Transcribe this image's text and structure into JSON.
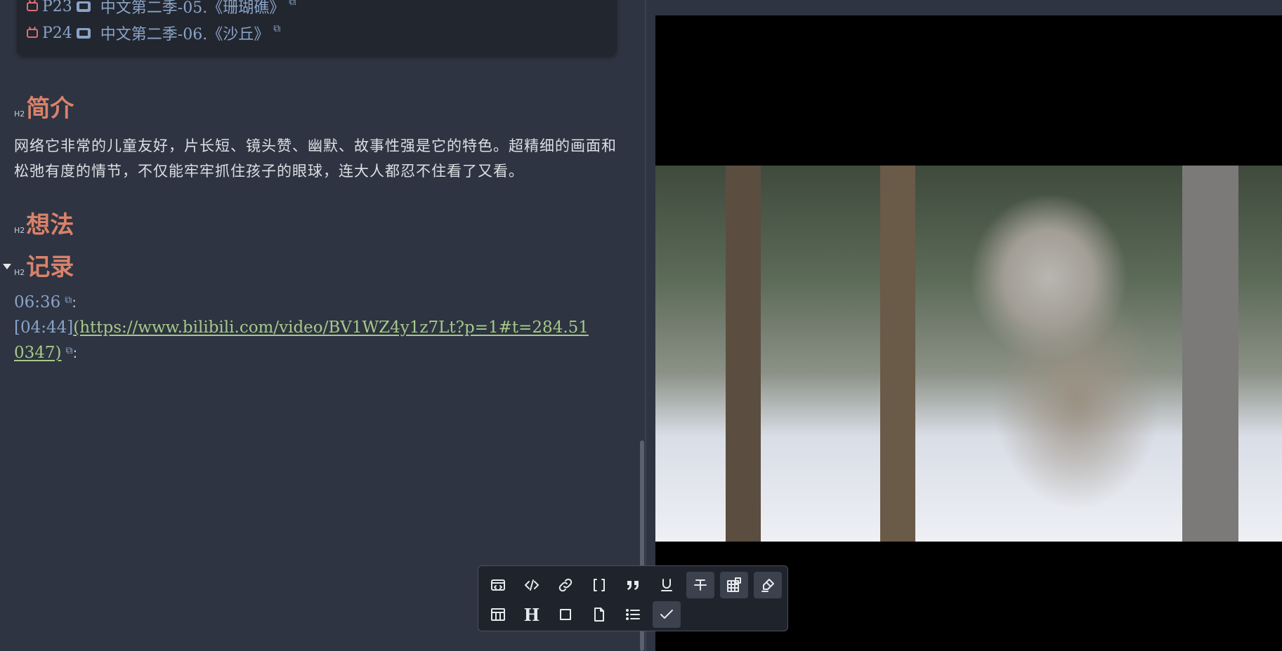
{
  "episodes": [
    {
      "label": "P23",
      "title": "中文第二季-05.《珊瑚礁》"
    },
    {
      "label": "P24",
      "title": "中文第二季-06.《沙丘》"
    }
  ],
  "sections": {
    "intro": {
      "tag": "H2",
      "title": "简介",
      "text": "网络它非常的儿童友好，片长短、镜头赞、幽默、故事性强是它的特色。超精细的画面和松弛有度的情节，不仅能牢牢抓住孩子的眼球，连大人都忍不住看了又看。"
    },
    "thoughts": {
      "tag": "H2",
      "title": "想法"
    },
    "records": {
      "tag": "H2",
      "title": "记录"
    }
  },
  "notes": [
    {
      "timestamp": "06:36",
      "suffix": ":"
    },
    {
      "prefix": "[04:44]",
      "url_line1": "(https://www.bilibili.com/video/BV1WZ4y1z7Lt?p=1#t=284.51",
      "url_line2": "0347)",
      "suffix": ":"
    }
  ],
  "toolbar": {
    "row1": [
      "embed-icon",
      "code-icon",
      "link-icon",
      "brackets-icon",
      "quote-icon",
      "underline-icon",
      "strikethrough-icon",
      "grid-icon",
      "highlighter-icon"
    ],
    "row2": [
      "table-icon",
      "heading-icon",
      "square-icon",
      "file-icon",
      "list-icon",
      "check-icon"
    ],
    "heading_glyph": "H"
  },
  "colors": {
    "accent_heading": "#d9826b",
    "link": "#a6c98a",
    "timestamp": "#8aa4c8",
    "background": "#2e3441"
  }
}
